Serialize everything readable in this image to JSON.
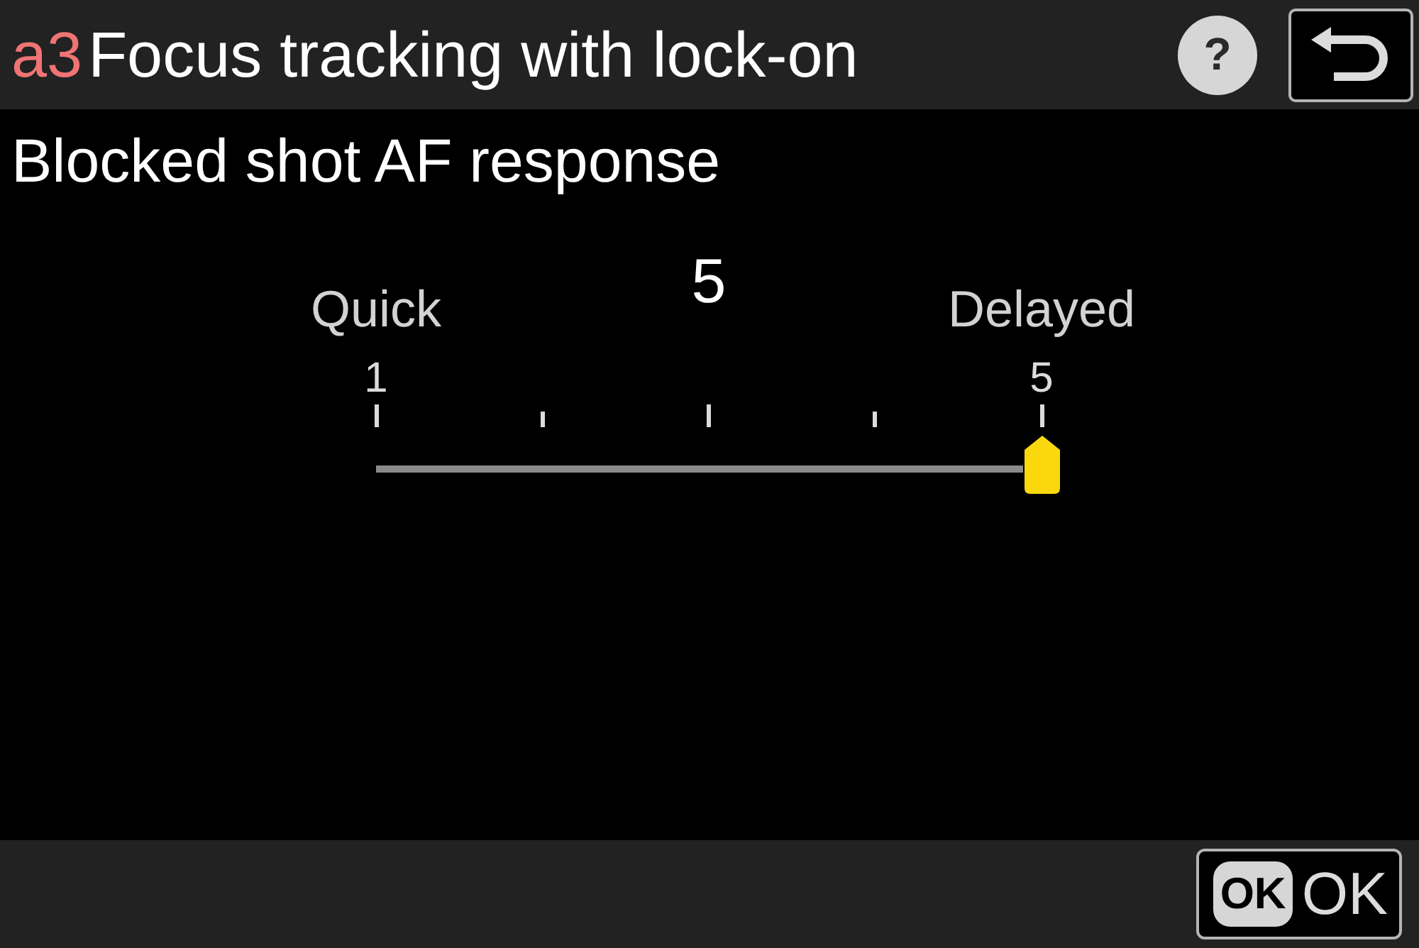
{
  "header": {
    "section_code": "a3",
    "title": "Focus tracking with lock-on",
    "help_label": "?"
  },
  "subtitle": "Blocked shot AF response",
  "slider": {
    "value": "5",
    "left_label": "Quick",
    "right_label": "Delayed",
    "ticks": [
      {
        "kind": "major",
        "label": "1"
      },
      {
        "kind": "minor"
      },
      {
        "kind": "major"
      },
      {
        "kind": "minor"
      },
      {
        "kind": "major",
        "label": "5"
      }
    ],
    "level": 1
  },
  "footer": {
    "ok_key": "OK",
    "ok_label": "OK"
  }
}
